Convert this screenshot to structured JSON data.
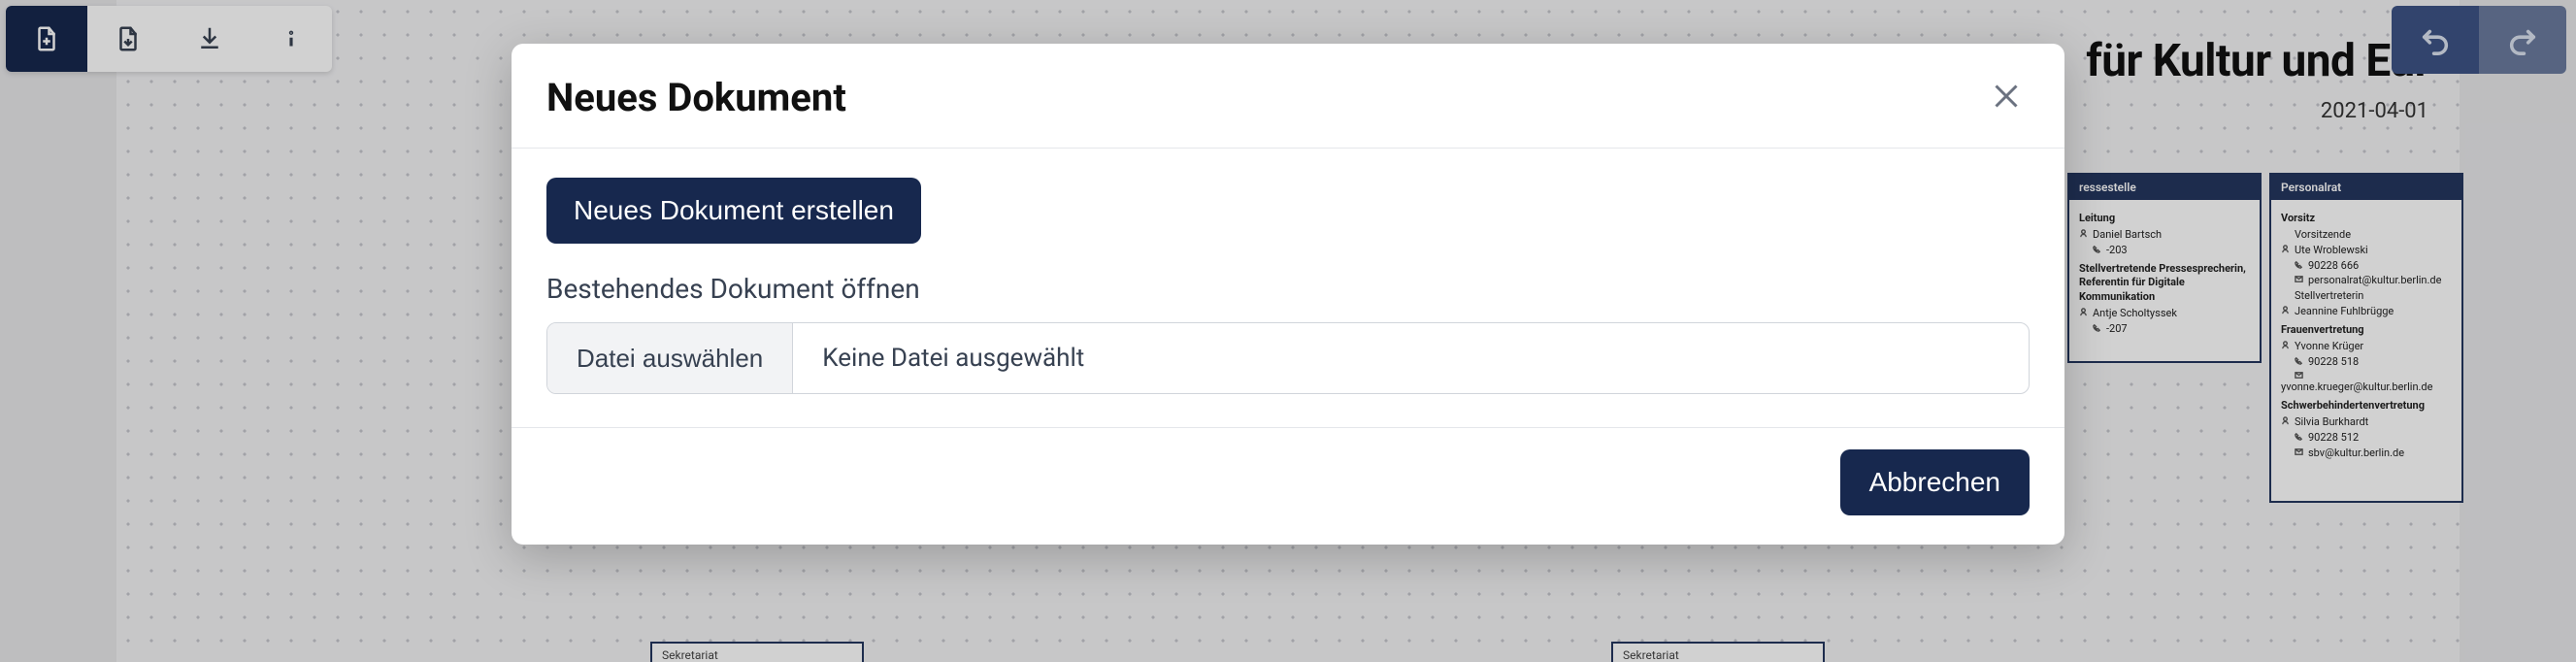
{
  "doc": {
    "title_fragment": "für Kultur und Eur",
    "date": "2021-04-01"
  },
  "toolbar": {
    "new_doc": "new-document",
    "open": "open",
    "download": "download",
    "info": "info"
  },
  "modal": {
    "title": "Neues Dokument",
    "create_btn": "Neues Dokument erstellen",
    "open_existing_label": "Bestehendes Dokument öffnen",
    "file_choose": "Datei auswählen",
    "file_none": "Keine Datei ausgewählt",
    "cancel": "Abbrechen"
  },
  "cards": [
    {
      "header": "ressestelle",
      "sections": [
        {
          "title": "Leitung",
          "entries": [
            {
              "icon": "person",
              "text": "Daniel Bartsch"
            },
            {
              "icon": "phone",
              "text": "-203"
            }
          ]
        },
        {
          "title": "Stellvertretende Pressesprecherin, Referentin für Digitale Kommunikation",
          "entries": [
            {
              "icon": "person",
              "text": "Antje Scholtyssek"
            },
            {
              "icon": "phone",
              "text": "-207"
            }
          ]
        }
      ]
    },
    {
      "header": "Personalrat",
      "sections": [
        {
          "title": "Vorsitz",
          "entries": [
            {
              "icon": "none",
              "text": "Vorsitzende"
            },
            {
              "icon": "person",
              "text": "Ute Wroblewski"
            },
            {
              "icon": "phone",
              "text": "90228 666"
            },
            {
              "icon": "mail",
              "text": "personalrat@kultur.berlin.de"
            },
            {
              "icon": "none",
              "text": "Stellvertreterin"
            },
            {
              "icon": "person",
              "text": "Jeannine Fuhlbrügge"
            }
          ]
        },
        {
          "title": "Frauenvertretung",
          "entries": [
            {
              "icon": "person",
              "text": "Yvonne Krüger"
            },
            {
              "icon": "phone",
              "text": "90228 518"
            },
            {
              "icon": "mail",
              "text": ""
            },
            {
              "icon": "none",
              "text": "yvonne.krueger@kultur.berlin.de"
            }
          ]
        },
        {
          "title": "Schwerbehindertenvertretung",
          "entries": [
            {
              "icon": "person",
              "text": "Silvia Burkhardt"
            },
            {
              "icon": "phone",
              "text": "90228 512"
            },
            {
              "icon": "mail",
              "text": "sbv@kultur.berlin.de"
            }
          ]
        }
      ]
    }
  ],
  "sek_label": "Sekretariat"
}
